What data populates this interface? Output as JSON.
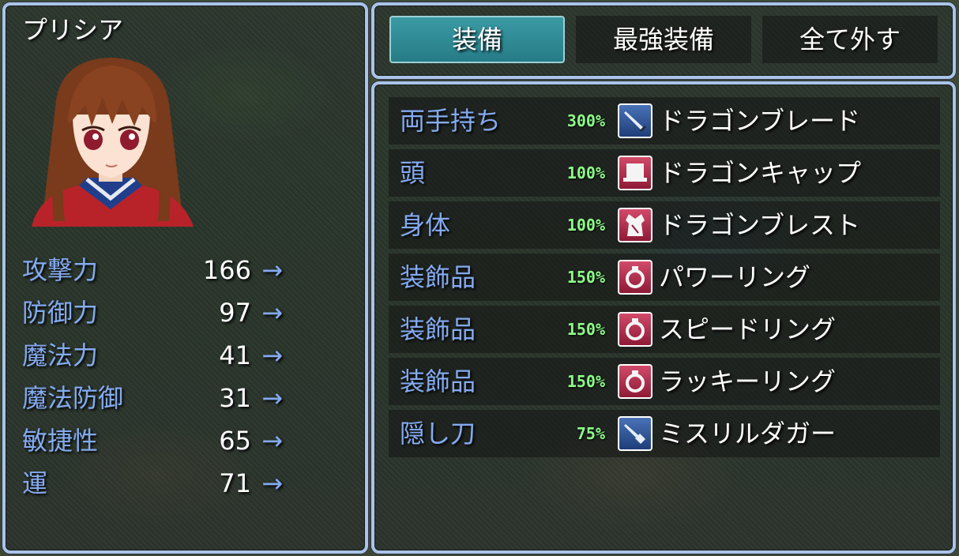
{
  "actor": {
    "name": "プリシア",
    "portrait_icon": "anime-girl-portrait"
  },
  "stats": [
    {
      "label": "攻撃力",
      "value": "166",
      "arrow": "→"
    },
    {
      "label": "防御力",
      "value": "97",
      "arrow": "→"
    },
    {
      "label": "魔法力",
      "value": "41",
      "arrow": "→"
    },
    {
      "label": "魔法防御",
      "value": "31",
      "arrow": "→"
    },
    {
      "label": "敏捷性",
      "value": "65",
      "arrow": "→"
    },
    {
      "label": "運",
      "value": "71",
      "arrow": "→"
    }
  ],
  "commands": [
    {
      "label": "装備",
      "selected": true
    },
    {
      "label": "最強装備",
      "selected": false
    },
    {
      "label": "全て外す",
      "selected": false
    }
  ],
  "slots": [
    {
      "label": "両手持ち",
      "percent": "300%",
      "icon": "sword-icon",
      "item": "ドラゴンブレード"
    },
    {
      "label": "頭",
      "percent": "100%",
      "icon": "cap-icon",
      "item": "ドラゴンキャップ"
    },
    {
      "label": "身体",
      "percent": "100%",
      "icon": "armor-icon",
      "item": "ドラゴンブレスト"
    },
    {
      "label": "装飾品",
      "percent": "150%",
      "icon": "ring-icon",
      "item": "パワーリング"
    },
    {
      "label": "装飾品",
      "percent": "150%",
      "icon": "ring-icon",
      "item": "スピードリング"
    },
    {
      "label": "装飾品",
      "percent": "150%",
      "icon": "ring-icon",
      "item": "ラッキーリング"
    },
    {
      "label": "隠し刀",
      "percent": "75%",
      "icon": "dagger-icon",
      "item": "ミスリルダガー"
    }
  ],
  "colors": {
    "system_blue": "#84aaf0",
    "percent_green": "#8cff88",
    "selected_command": "#2f8c96",
    "window_border": "#a9c4e8"
  }
}
